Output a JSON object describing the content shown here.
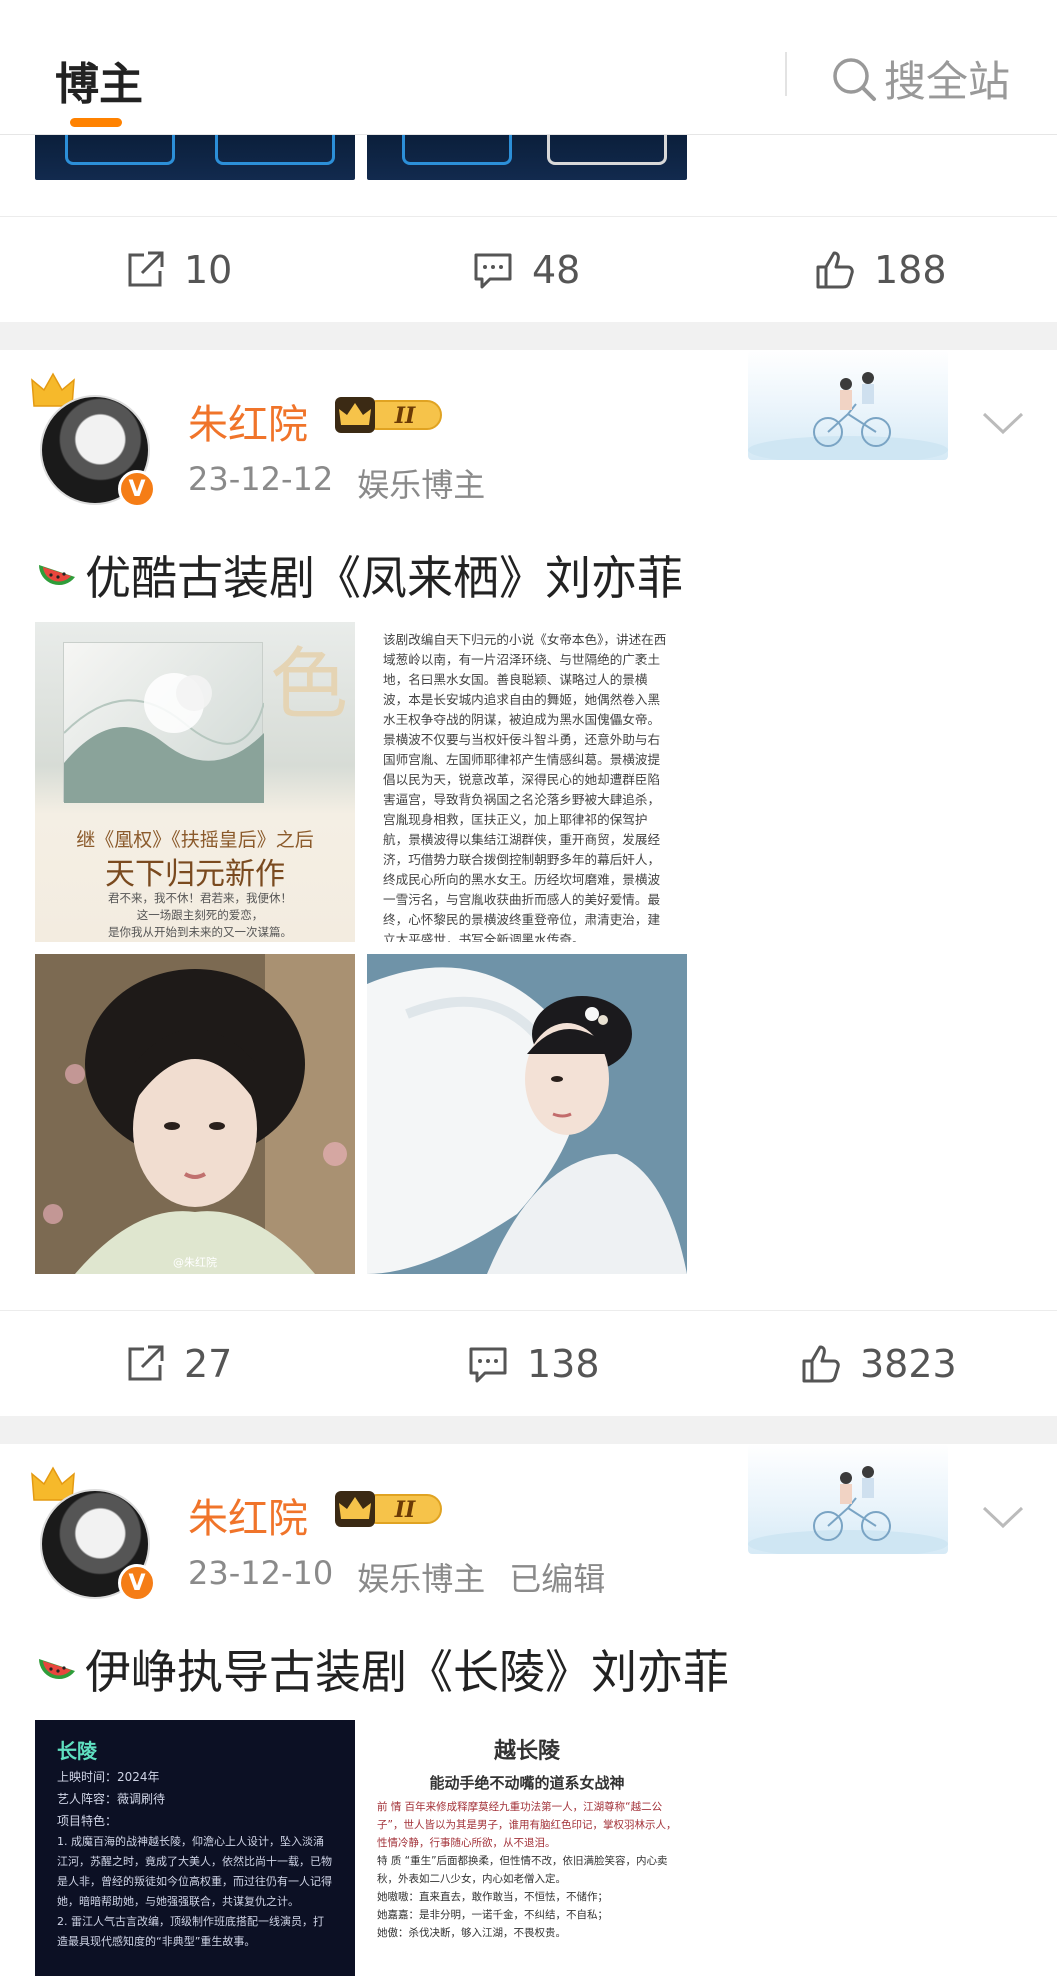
{
  "header": {
    "tab_label": "博主",
    "search_label": "搜全站"
  },
  "prev_post": {
    "repost_count": "10",
    "comment_count": "48",
    "like_count": "188"
  },
  "posts": [
    {
      "username": "朱红院",
      "level": "II",
      "verified_mark": "V",
      "date": "23-12-12",
      "category": "娱乐博主",
      "edited": "",
      "title": "优酷古装剧《凤来栖》刘亦菲",
      "book": {
        "big_char": "色",
        "tagline": "继《凰权》《扶摇皇后》之后",
        "headline": "天下归元新作",
        "poem": "君不来，我不休！君若来，我便休！\n这一场跟主刻死的爱恋，\n是你我从开始到未来的又一次谋篇。"
      },
      "synopsis": "该剧改编自天下归元的小说《女帝本色》，讲述在西域葱岭以南，有一片沼泽环绕、与世隔绝的广袤土地，名曰黑水女国。善良聪颖、谋略过人的景横波，本是长安城内追求自由的舞姬，她偶然卷入黑水王权争夺战的阴谋，被迫成为黑水国傀儡女帝。景横波不仅要与当权奸佞斗智斗勇，还意外助与右国师宫胤、左国师耶律祁产生情感纠葛。景横波提倡以民为天，锐意改革，深得民心的她却遭群臣陷害逼宫，导致背负祸国之名沦落乡野被大肆追杀，宫胤现身相救，匡扶正义，加上耶律祁的保驾护航，景横波得以集结江湖群侠，重开商贸，发展经济，巧借势力联合拨倒控制朝野多年的幕后奸人，终成民心所向的黑水女王。历经坎坷磨难，景横波一雪污名，与宫胤收获曲折而感人的美好爱情。最终，心怀黎民的景横波终重登帝位，肃清吏治，建立太平盛世，书写全新调黑水传奇。",
      "watermark": "@朱红院",
      "repost_count": "27",
      "comment_count": "138",
      "like_count": "3823"
    },
    {
      "username": "朱红院",
      "level": "II",
      "verified_mark": "V",
      "date": "23-12-10",
      "category": "娱乐博主",
      "edited": "已编辑",
      "title": "伊峥执导古装剧《长陵》刘亦菲",
      "card_dark": {
        "heading": "长陵",
        "lines": [
          "上映时间：2024年",
          "艺人阵容：薇调刷待",
          "项目特色：",
          "1. 成魔百海的战神越长陵，仰澹心上人设计，坠入淡涌江河，苏醒之时，竟成了大美人，依然比尚十一载，已物是人非，曾经的叛徒如今位高权重，而过往仍有一人记得她，暗暗帮助她，与她强强联合，共谋复仇之计。",
          "2. 雷江人气古言改编，顶级制作班底搭配一线演员，打造最具现代感知度的“非典型”重生故事。"
        ]
      },
      "card_white": {
        "heading": "越长陵",
        "subheading": "能动手绝不动嘴的道系女战神",
        "lines": [
          "前 情  百年来修成释摩莫经九重功法第一人，江湖尊称“越二公子”，世人皆以为其是男子，谁用有脑红色印记，掌权羽林示人，性情冷静，行事随心所欲，从不退泪。",
          "特 质  “重生”后面都换柔，但性情不改，依旧满脸笑容，内心卖秋，外表如二八少女，内心如老僧入定。",
          "她嗷嗷：直来直去，敢作敢当，不恒怯，不储作；",
          "她嘉嘉：是非分明，一诺千金，不纠结，不自私；",
          "她傲：杀伐决断，够入江湖，不畏权贵。"
        ]
      }
    }
  ]
}
